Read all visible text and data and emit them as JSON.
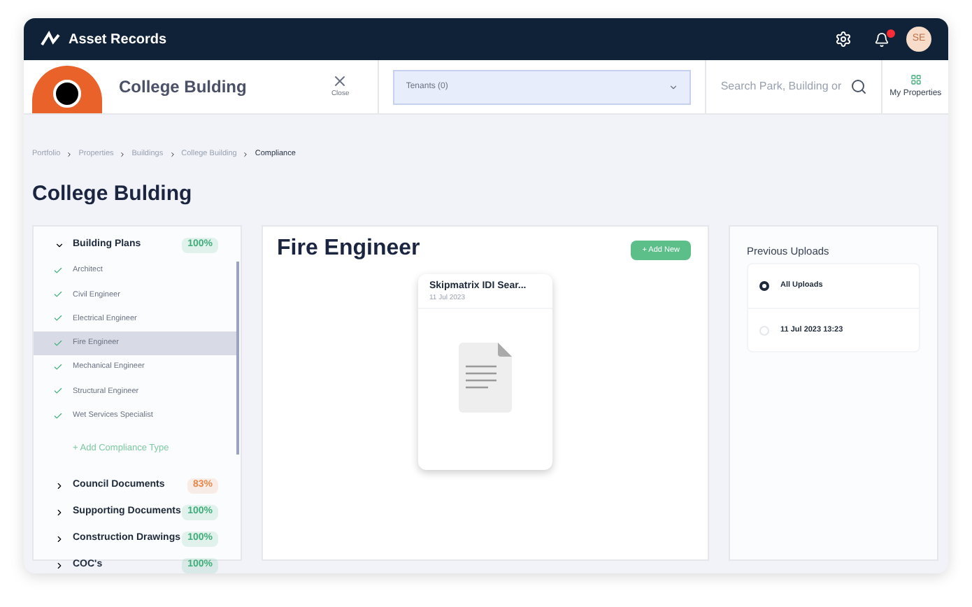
{
  "app": {
    "name_1": "Asset",
    "name_2": "Records",
    "avatar": "SE"
  },
  "building_bar": {
    "title": "College Bulding",
    "close": "Close",
    "tenants": "Tenants (0)",
    "search_placeholder": "Search Park, Building or",
    "my_properties": "My Properties"
  },
  "breadcrumb": [
    {
      "label": "Portfolio",
      "current": false
    },
    {
      "label": "Properties",
      "current": false
    },
    {
      "label": "Buildings",
      "current": false
    },
    {
      "label": "College Building",
      "current": false
    },
    {
      "label": "Compliance",
      "current": true
    }
  ],
  "page_title": "College Bulding",
  "tree": [
    {
      "label": "Building Plans",
      "badge": "100%",
      "color": "#3fae7a",
      "expanded": true,
      "children": [
        {
          "label": "Architect",
          "checked": true,
          "selected": false
        },
        {
          "label": "Civil Engineer",
          "checked": true,
          "selected": false
        },
        {
          "label": "Electrical Engineer",
          "checked": true,
          "selected": false
        },
        {
          "label": "Fire Engineer",
          "checked": true,
          "selected": true
        },
        {
          "label": "Mechanical Engineer",
          "checked": true,
          "selected": false
        },
        {
          "label": "Structural Engineer",
          "checked": true,
          "selected": false
        },
        {
          "label": "Wet Services Specialist",
          "checked": true,
          "selected": false
        }
      ],
      "add_label": "+ Add Compliance Type"
    },
    {
      "label": "Council Documents",
      "badge": "83%",
      "color": "#e8894a",
      "expanded": false
    },
    {
      "label": "Supporting Documents",
      "badge": "100%",
      "color": "#3fae7a",
      "expanded": false
    },
    {
      "label": "Construction Drawings",
      "badge": "100%",
      "color": "#3fae7a",
      "expanded": false
    },
    {
      "label": "COC's",
      "badge": "100%",
      "color": "#3fae7a",
      "expanded": false
    }
  ],
  "content": {
    "title": "Fire Engineer",
    "add_button": "+ Add New",
    "documents": [
      {
        "name": "Skipmatrix IDI Sear...",
        "date": "11 Jul 2023"
      }
    ]
  },
  "uploads": {
    "title": "Previous Uploads",
    "options": [
      {
        "label": "All Uploads",
        "selected": true
      },
      {
        "label": "11 Jul 2023 13:23",
        "selected": false
      }
    ]
  }
}
